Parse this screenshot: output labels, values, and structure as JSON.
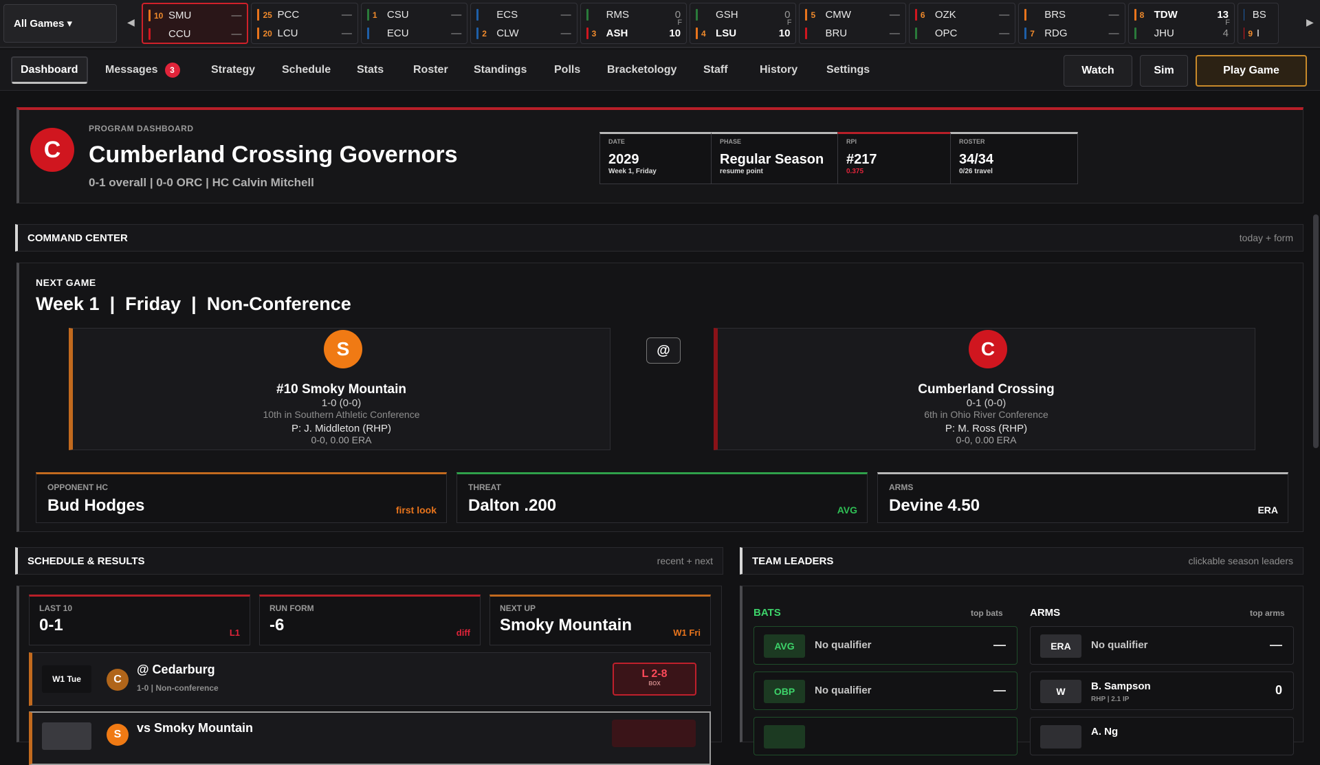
{
  "scoreboard": {
    "filter": "All Games ▾",
    "games": [
      {
        "t1": {
          "rank": "10",
          "abbr": "SMU",
          "score": "—",
          "color": "#e8741c"
        },
        "t2": {
          "rank": "",
          "abbr": "CCU",
          "score": "—",
          "color": "#d0161f"
        },
        "status": ""
      },
      {
        "t1": {
          "rank": "25",
          "abbr": "PCC",
          "score": "—",
          "color": "#e8741c"
        },
        "t2": {
          "rank": "20",
          "abbr": "LCU",
          "score": "—",
          "color": "#e8741c"
        },
        "status": ""
      },
      {
        "t1": {
          "rank": "1",
          "abbr": "CSU",
          "score": "—",
          "color": "#2a7a3a"
        },
        "t2": {
          "rank": "",
          "abbr": "ECU",
          "score": "—",
          "color": "#1e5fa8"
        },
        "status": ""
      },
      {
        "t1": {
          "rank": "",
          "abbr": "ECS",
          "score": "—",
          "color": "#1e5fa8"
        },
        "t2": {
          "rank": "2",
          "abbr": "CLW",
          "score": "—",
          "color": "#1e5fa8"
        },
        "status": ""
      },
      {
        "t1": {
          "rank": "",
          "abbr": "RMS",
          "score": "0",
          "color": "#2a7a3a"
        },
        "t2": {
          "rank": "3",
          "abbr": "ASH",
          "score": "10",
          "color": "#d0161f",
          "win": true
        },
        "status": "F"
      },
      {
        "t1": {
          "rank": "",
          "abbr": "GSH",
          "score": "0",
          "color": "#2a7a3a"
        },
        "t2": {
          "rank": "4",
          "abbr": "LSU",
          "score": "10",
          "color": "#e8741c",
          "win": true
        },
        "status": "F"
      },
      {
        "t1": {
          "rank": "5",
          "abbr": "CMW",
          "score": "—",
          "color": "#e8741c"
        },
        "t2": {
          "rank": "",
          "abbr": "BRU",
          "score": "—",
          "color": "#d0161f"
        },
        "status": ""
      },
      {
        "t1": {
          "rank": "6",
          "abbr": "OZK",
          "score": "—",
          "color": "#d0161f"
        },
        "t2": {
          "rank": "",
          "abbr": "OPC",
          "score": "—",
          "color": "#2a7a3a"
        },
        "status": ""
      },
      {
        "t1": {
          "rank": "",
          "abbr": "BRS",
          "score": "—",
          "color": "#e8741c"
        },
        "t2": {
          "rank": "7",
          "abbr": "RDG",
          "score": "—",
          "color": "#1e5fa8"
        },
        "status": ""
      },
      {
        "t1": {
          "rank": "8",
          "abbr": "TDW",
          "score": "13",
          "color": "#e8741c",
          "win": true
        },
        "t2": {
          "rank": "",
          "abbr": "JHU",
          "score": "4",
          "color": "#2a7a3a"
        },
        "status": "F"
      },
      {
        "t1": {
          "rank": "",
          "abbr": "BS",
          "score": "",
          "color": "#1e5fa8"
        },
        "t2": {
          "rank": "9",
          "abbr": "I",
          "score": "",
          "color": "#d0161f"
        },
        "status": ""
      }
    ]
  },
  "nav": {
    "tabs": [
      "Dashboard",
      "Messages",
      "Strategy",
      "Schedule",
      "Stats",
      "Roster",
      "Standings",
      "Polls",
      "Bracketology",
      "Staff",
      "History",
      "Settings"
    ],
    "messages_badge": "3",
    "watch": "Watch",
    "sim": "Sim",
    "play": "Play Game"
  },
  "header": {
    "kicker": "PROGRAM DASHBOARD",
    "logo": "C",
    "title": "Cumberland Crossing Governors",
    "subtitle": "0-1 overall | 0-0 ORC | HC Calvin Mitchell",
    "stats": [
      {
        "k": "DATE",
        "v": "2029",
        "s": "Week 1, Friday",
        "color": "#b8b8b8"
      },
      {
        "k": "PHASE",
        "v": "Regular Season",
        "s": "resume point",
        "color": "#b8b8b8"
      },
      {
        "k": "RPI",
        "v": "#217",
        "s": "0.375",
        "color": "#b81f28"
      },
      {
        "k": "ROSTER",
        "v": "34/34",
        "s": "0/26 travel",
        "color": "#b8b8b8"
      }
    ]
  },
  "command": {
    "title": "COMMAND CENTER",
    "right": "today + form"
  },
  "next_game": {
    "kicker": "NEXT GAME",
    "title": "Week 1  |  Friday  |  Non-Conference",
    "at": "@",
    "away": {
      "logo": "S",
      "name": "#10 Smoky Mountain",
      "record": "1-0  (0-0)",
      "standing": "10th in Southern Athletic Conference",
      "pitcher": "P: J. Middleton (RHP)",
      "pline": "0-0, 0.00 ERA",
      "color": "#f07a14"
    },
    "home": {
      "logo": "C",
      "name": "Cumberland Crossing",
      "record": "0-1  (0-0)",
      "standing": "6th in Ohio River Conference",
      "pitcher": "P: M. Ross (RHP)",
      "pline": "0-0, 0.00 ERA",
      "color": "#d0161f"
    },
    "cards": [
      {
        "k": "OPPONENT HC",
        "v": "Bud Hodges",
        "t": "first look",
        "color": "#c26a1e"
      },
      {
        "k": "THREAT",
        "v": "Dalton .200",
        "t": "AVG",
        "color": "#2fa04a"
      },
      {
        "k": "ARMS",
        "v": "Devine 4.50",
        "t": "ERA",
        "color": "#b8b8b8"
      }
    ]
  },
  "schedule": {
    "title": "SCHEDULE & RESULTS",
    "right": "recent + next",
    "minis": [
      {
        "k": "LAST 10",
        "v": "0-1",
        "t": "L1",
        "color": "#b81f28"
      },
      {
        "k": "RUN FORM",
        "v": "-6",
        "t": "diff",
        "color": "#b81f28"
      },
      {
        "k": "NEXT UP",
        "v": "Smoky Mountain",
        "t": "W1 Fri",
        "color": "#c26a1e"
      }
    ],
    "rows": [
      {
        "wk": "W1 Tue",
        "logo": "C",
        "opp": "@ Cedarburg",
        "info": "1-0 | Non-conference",
        "res": "L 2-8",
        "box": "BOX"
      },
      {
        "wk": "",
        "logo": "S",
        "opp": "vs Smoky Mountain",
        "info": "",
        "res": "",
        "box": ""
      }
    ]
  },
  "leaders": {
    "title": "TEAM LEADERS",
    "right": "clickable season leaders",
    "bats_label": "BATS",
    "bats_sub": "top bats",
    "arms_label": "ARMS",
    "arms_sub": "top arms",
    "bats": [
      {
        "tag": "AVG",
        "name": "No qualifier",
        "val": "—"
      },
      {
        "tag": "OBP",
        "name": "No qualifier",
        "val": "—"
      }
    ],
    "arms": [
      {
        "tag": "ERA",
        "name": "No qualifier",
        "sub": "",
        "val": "—"
      },
      {
        "tag": "W",
        "name": "B. Sampson",
        "sub": "RHP | 2.1 IP",
        "val": "0"
      },
      {
        "tag": "",
        "name": "A. Ng",
        "sub": "",
        "val": ""
      }
    ]
  }
}
